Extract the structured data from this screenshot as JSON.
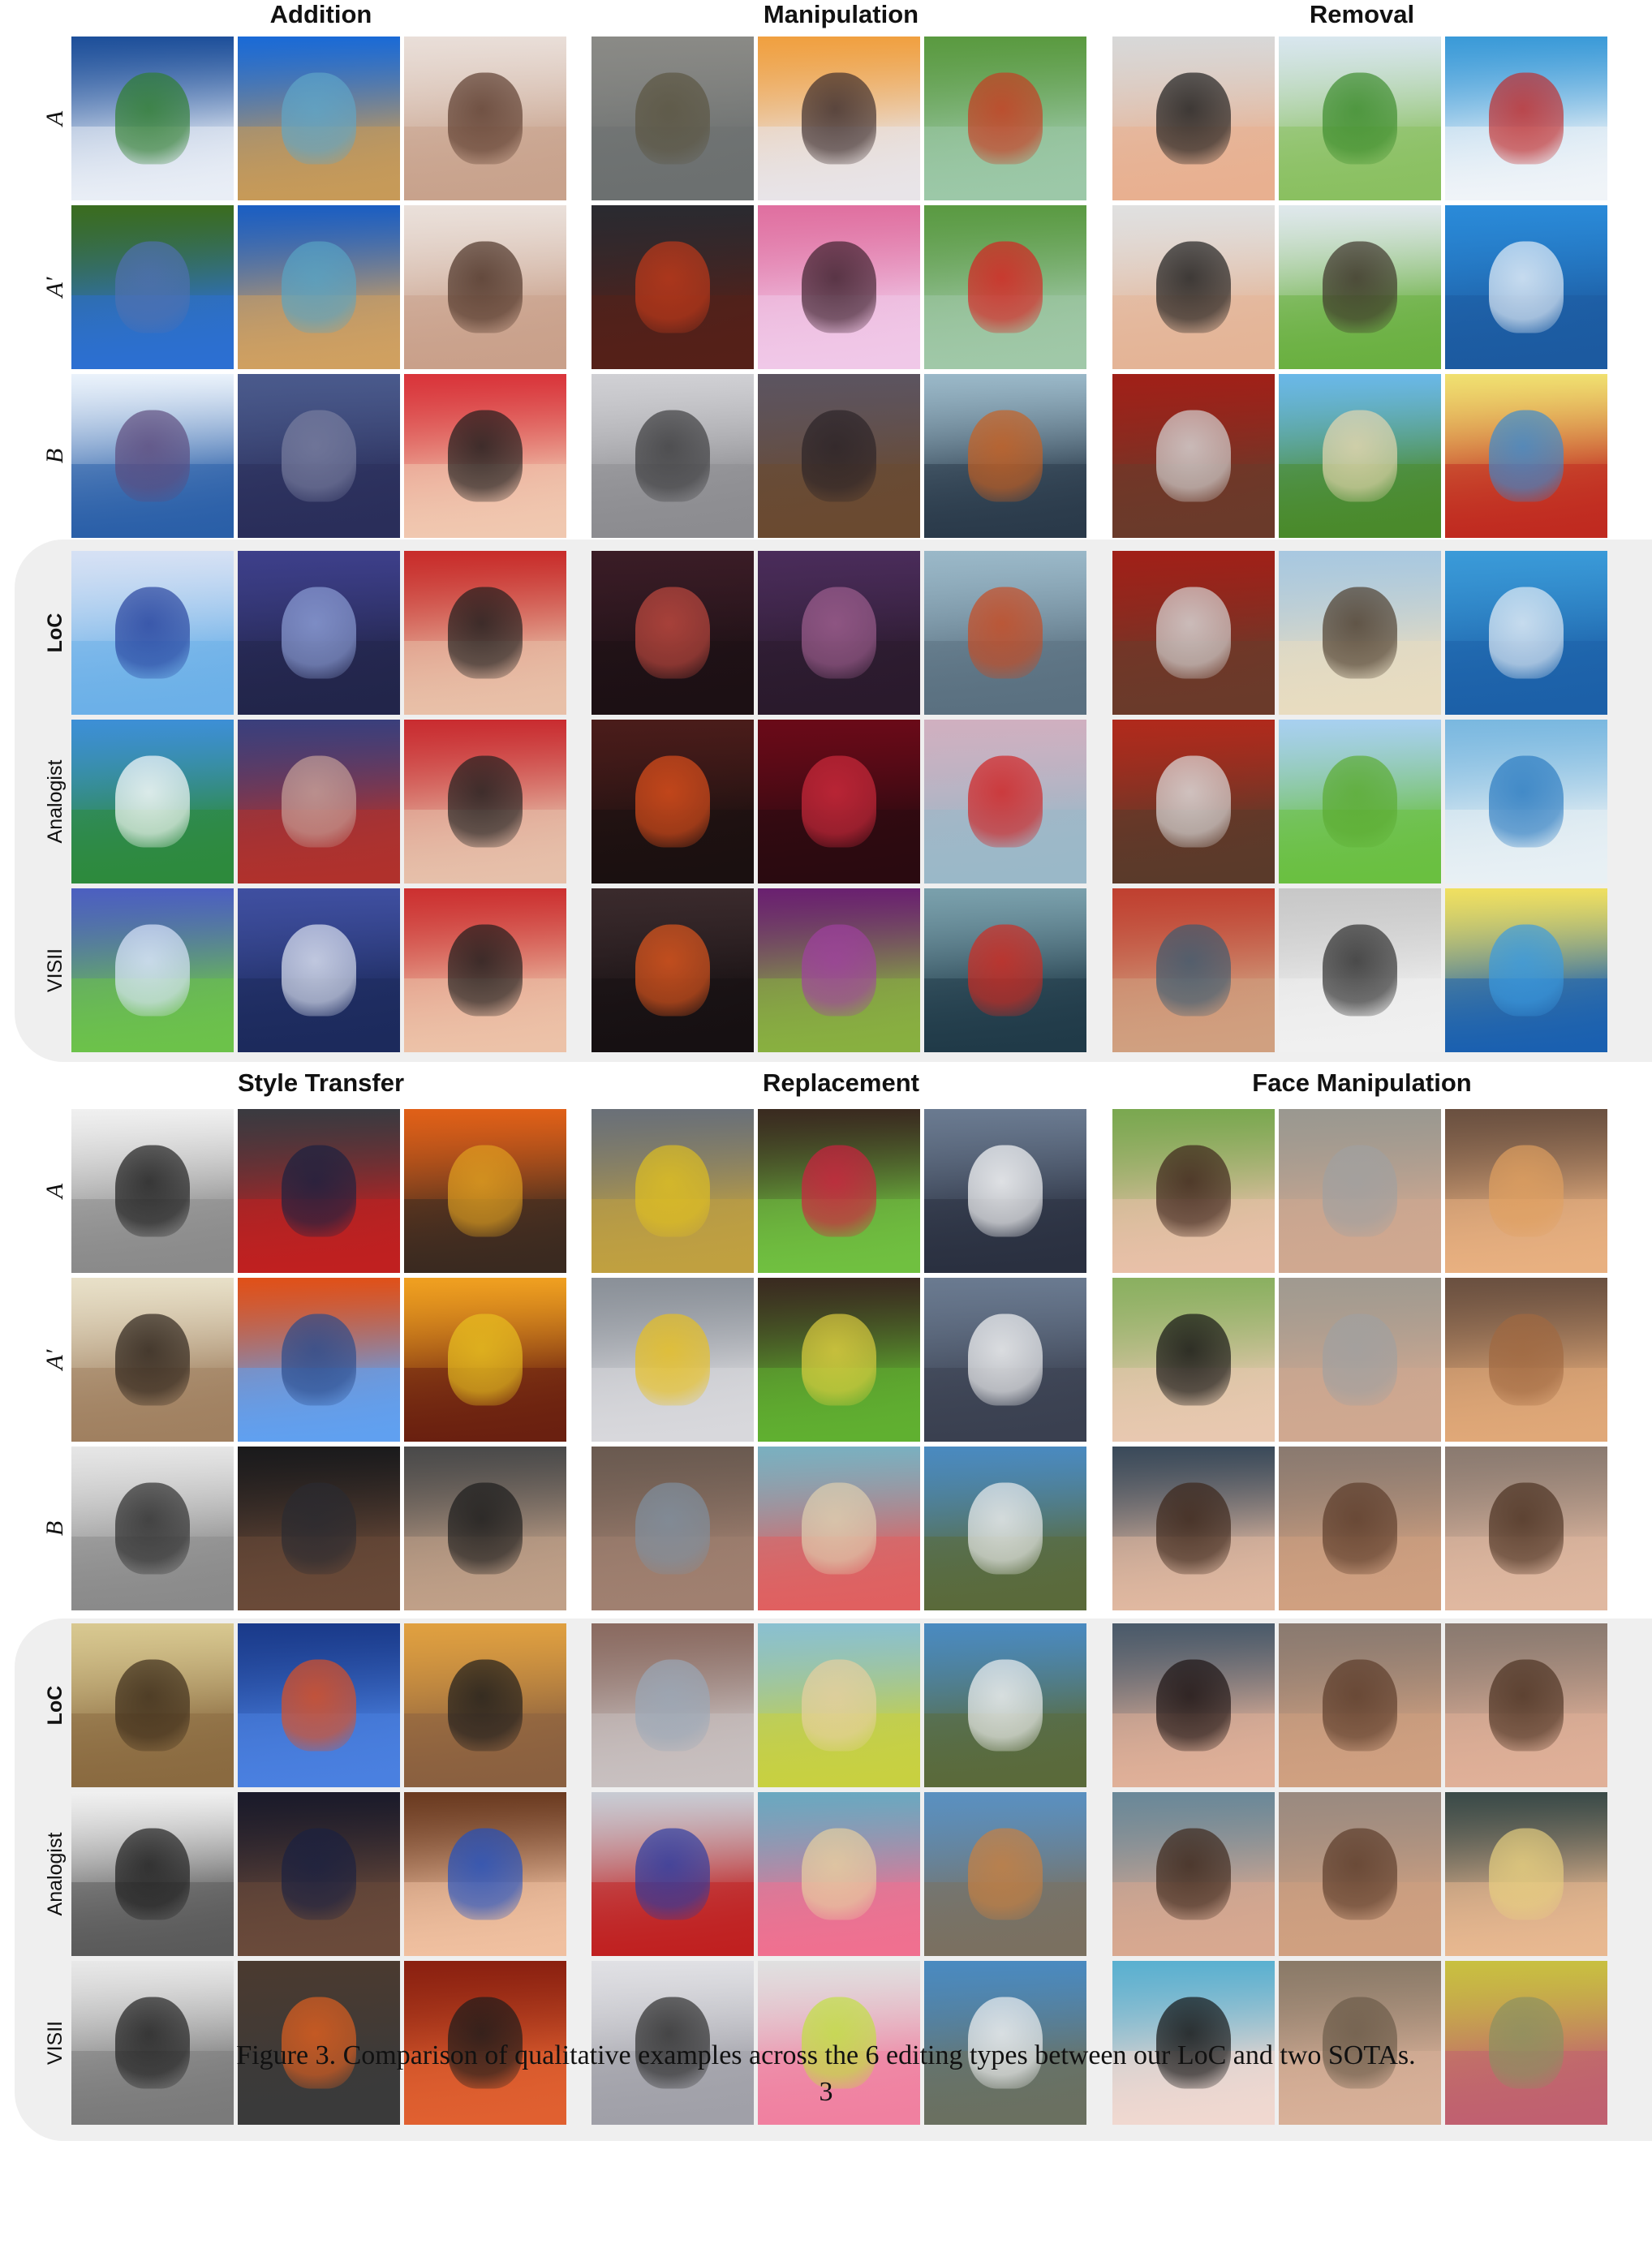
{
  "figure": {
    "caption": "Figure 3. Comparison of qualitative examples across the 6 editing types between our LoC and two SOTAs.",
    "page_number": "3",
    "row_labels": [
      "A",
      "A′",
      "B",
      "LoC",
      "Analogist",
      "VISII"
    ],
    "blocks": [
      {
        "sections": [
          {
            "title": "Addition",
            "columns": [
              [
                "#1d4f9a",
                "#2f7d2e",
                "#e9eef6",
                "#3a6c1f",
                "#5070b0",
                "#2c6fd2",
                "#eaf2fb",
                "#5c4a7c",
                "#2a5fa8",
                "#d6e1f4",
                "#24409c",
                "#6bb0e8",
                "#3d8fd6",
                "#ffffff",
                "#2d8a3c",
                "#4c5fc0",
                "#dfe9ff",
                "#6cc24a"
              ],
              [
                "#1a6ad6",
                "#5fa6c8",
                "#c79a58",
                "#1b5ec2",
                "#58a4c4",
                "#d0a060",
                "#4a5a8c",
                "#7a7fa0",
                "#2a2e5a",
                "#3d3f8a",
                "#8ea0d8",
                "#22254a",
                "#3a3f7c",
                "#c8a29a",
                "#b0312c",
                "#3f4fa0",
                "#e0e6f4",
                "#1c2a5c"
              ],
              [
                "#e9ded8",
                "#5a3a2c",
                "#c8a28c",
                "#eae0da",
                "#4a3024",
                "#c9a08a",
                "#d9343a",
                "#1a1a1a",
                "#f0c8b0",
                "#c82c2a",
                "#1b1b1b",
                "#e8c0a8",
                "#c92c30",
                "#1d1d1d",
                "#e6c0aa",
                "#cc3030",
                "#1a1a1a",
                "#ecc2a8"
              ]
            ]
          },
          {
            "title": "Manipulation",
            "columns": [
              [
                "#8a8a86",
                "#5a5440",
                "#6c7070",
                "#2a2a30",
                "#c23a1a",
                "#552018",
                "#d0d0d4",
                "#3a3a3c",
                "#8c8c90",
                "#3a1c26",
                "#c24a40",
                "#1c1014",
                "#4a1c1a",
                "#e0501c",
                "#1a1010",
                "#3a2a2c",
                "#e2581e",
                "#161012"
              ],
              [
                "#f0a040",
                "#3a2a2a",
                "#e8e4e8",
                "#e070a0",
                "#3a1e2a",
                "#f0c8e8",
                "#5c5460",
                "#2a2226",
                "#6a4a30",
                "#4a2c5a",
                "#a06090",
                "#2a1a2c",
                "#6a0a18",
                "#d02a3c",
                "#2a0a10",
                "#6a2070",
                "#a040a0",
                "#88b040"
              ],
              [
                "#5a9a40",
                "#c83a20",
                "#9cc8a8",
                "#5a9a42",
                "#d82020",
                "#a0c8a8",
                "#9ab8c8",
                "#c86020",
                "#2a3a4a",
                "#9ab8c8",
                "#c84a20",
                "#5a7080",
                "#d0b0c0",
                "#d02020",
                "#9ab8c8",
                "#7aa0ac",
                "#d02a20",
                "#203a48"
              ]
            ]
          },
          {
            "title": "Removal",
            "columns": [
              [
                "#d8d8d8",
                "#1a1a1a",
                "#e8b090",
                "#e0e0e0",
                "#1a1a1a",
                "#e4b496",
                "#a02018",
                "#d8d8d8",
                "#6a3a2a",
                "#a02018",
                "#dadada",
                "#6a3a2a",
                "#b02a1c",
                "#e0e0e0",
                "#5a3a2a",
                "#c04030",
                "#3a5a70",
                "#d0a080"
              ],
              [
                "#d8e6ee",
                "#3a8a2a",
                "#8ac060",
                "#dfe8ec",
                "#3a3026",
                "#6ab040",
                "#6ab8e8",
                "#e8d8b0",
                "#4a8a2a",
                "#a8c8e0",
                "#4a3a2a",
                "#e8dcc0",
                "#a8d0f0",
                "#5aaa30",
                "#6ac040",
                "#c8c8c8",
                "#2a2a2a",
                "#f0f0f0"
              ],
              [
                "#3a9ad8",
                "#c02a2a",
                "#f0f4f8",
                "#2a8ad8",
                "#eaf2fa",
                "#1c5aa0",
                "#f0e070",
                "#3a8ad0",
                "#c02a20",
                "#3a9ad8",
                "#e8f0f8",
                "#1c60a8",
                "#7ab8e0",
                "#2a7ac0",
                "#e8f0f4",
                "#f0e060",
                "#3a9ae0",
                "#1a60b0"
              ]
            ]
          }
        ]
      },
      {
        "sections": [
          {
            "title": "Style Transfer",
            "columns": [
              [
                "#f0f0f0",
                "#1a1a1a",
                "#8a8a8a",
                "#e8e0c8",
                "#2a2018",
                "#a08060",
                "#e6e6e6",
                "#2a2a2a",
                "#8a8a8a",
                "#d8c890",
                "#3a2a18",
                "#8a6a40",
                "#f0f0f0",
                "#1a1a1a",
                "#5a5a5a",
                "#e8e8e8",
                "#1c1c1c",
                "#7a7a7a"
              ],
              [
                "#3a3a40",
                "#1a2040",
                "#c02020",
                "#e05018",
                "#2a4a8a",
                "#60a0f0",
                "#1a1a1c",
                "#2a2a30",
                "#6a4a38",
                "#1a3a8a",
                "#e05020",
                "#4a80e0",
                "#1a1a2a",
                "#1a2040",
                "#6a4a3a",
                "#4a3a30",
                "#e06020",
                "#3a3a3a"
              ],
              [
                "#e06018",
                "#e0a020",
                "#3a2a20",
                "#f0a020",
                "#e8c020",
                "#6a2010",
                "#4a4a4a",
                "#1a1a1a",
                "#c0a088",
                "#e0a040",
                "#1a1a1a",
                "#8a6040",
                "#6a3a20",
                "#2050c0",
                "#f0c0a0",
                "#8a2010",
                "#1a1a1a",
                "#e06030"
              ]
            ]
          },
          {
            "title": "Replacement",
            "columns": [
              [
                "#6a7078",
                "#e0c020",
                "#c0a040",
                "#8a9098",
                "#e8c020",
                "#d8d8dc",
                "#6a5a50",
                "#8090a0",
                "#a08070",
                "#8a6a60",
                "#9aa8b8",
                "#c8c0c0",
                "#c8ccd4",
                "#2a3aa0",
                "#c02020",
                "#e0e0e4",
                "#2a2a2a",
                "#a0a0a8"
              ],
              [
                "#3a2a20",
                "#d02040",
                "#70c040",
                "#3a2a20",
                "#e0d040",
                "#60b030",
                "#7ab0c0",
                "#e0d0b0",
                "#e06060",
                "#8ac0d0",
                "#e8d0a0",
                "#c8d040",
                "#6aa8c0",
                "#e8d0a0",
                "#f07090",
                "#e0e0e0",
                "#c0e040",
                "#f080a0"
              ],
              [
                "#6a7a90",
                "#ffffff",
                "#2a3040",
                "#6a7a90",
                "#f8f8f8",
                "#3a4050",
                "#4a8ac0",
                "#f0f0f0",
                "#5a6a3a",
                "#4a8ac0",
                "#f4f4f4",
                "#5a6a3a",
                "#5a90c0",
                "#c88040",
                "#7a7060",
                "#4a8ac0",
                "#f4f4f4",
                "#6a7060"
              ]
            ]
          },
          {
            "title": "Face Manipulation",
            "columns": [
              [
                "#7aa850",
                "#3a2018",
                "#e8c0a8",
                "#8ab060",
                "#101010",
                "#e8c8b0",
                "#3a4a5a",
                "#3a2418",
                "#e0b8a0",
                "#4a5a6a",
                "#1a1010",
                "#e0b098",
                "#6a8898",
                "#3a2418",
                "#d8a890",
                "#5ab0d0",
                "#101010",
                "#f0d8d0"
              ],
              [
                "#9a9890",
                "#a0a0a0",
                "#d0a890",
                "#a09a90",
                "#a0a0a0",
                "#d0a890",
                "#8a7a70",
                "#5a3a28",
                "#d0a080",
                "#8a7a70",
                "#5a3a28",
                "#d0a080",
                "#9a8a80",
                "#5a3a28",
                "#d0a080",
                "#8a7a68",
                "#6a5a48",
                "#d8b098"
              ],
              [
                "#6a5040",
                "#e0a060",
                "#e8b080",
                "#6a5040",
                "#a06840",
                "#e0a878",
                "#8a7a70",
                "#4a3020",
                "#e0b8a0",
                "#8a7a70",
                "#4a3020",
                "#e0b098",
                "#3a4a48",
                "#e8d080",
                "#e8b890",
                "#c8c040",
                "#8a9060",
                "#c06070"
              ]
            ]
          }
        ]
      }
    ]
  }
}
